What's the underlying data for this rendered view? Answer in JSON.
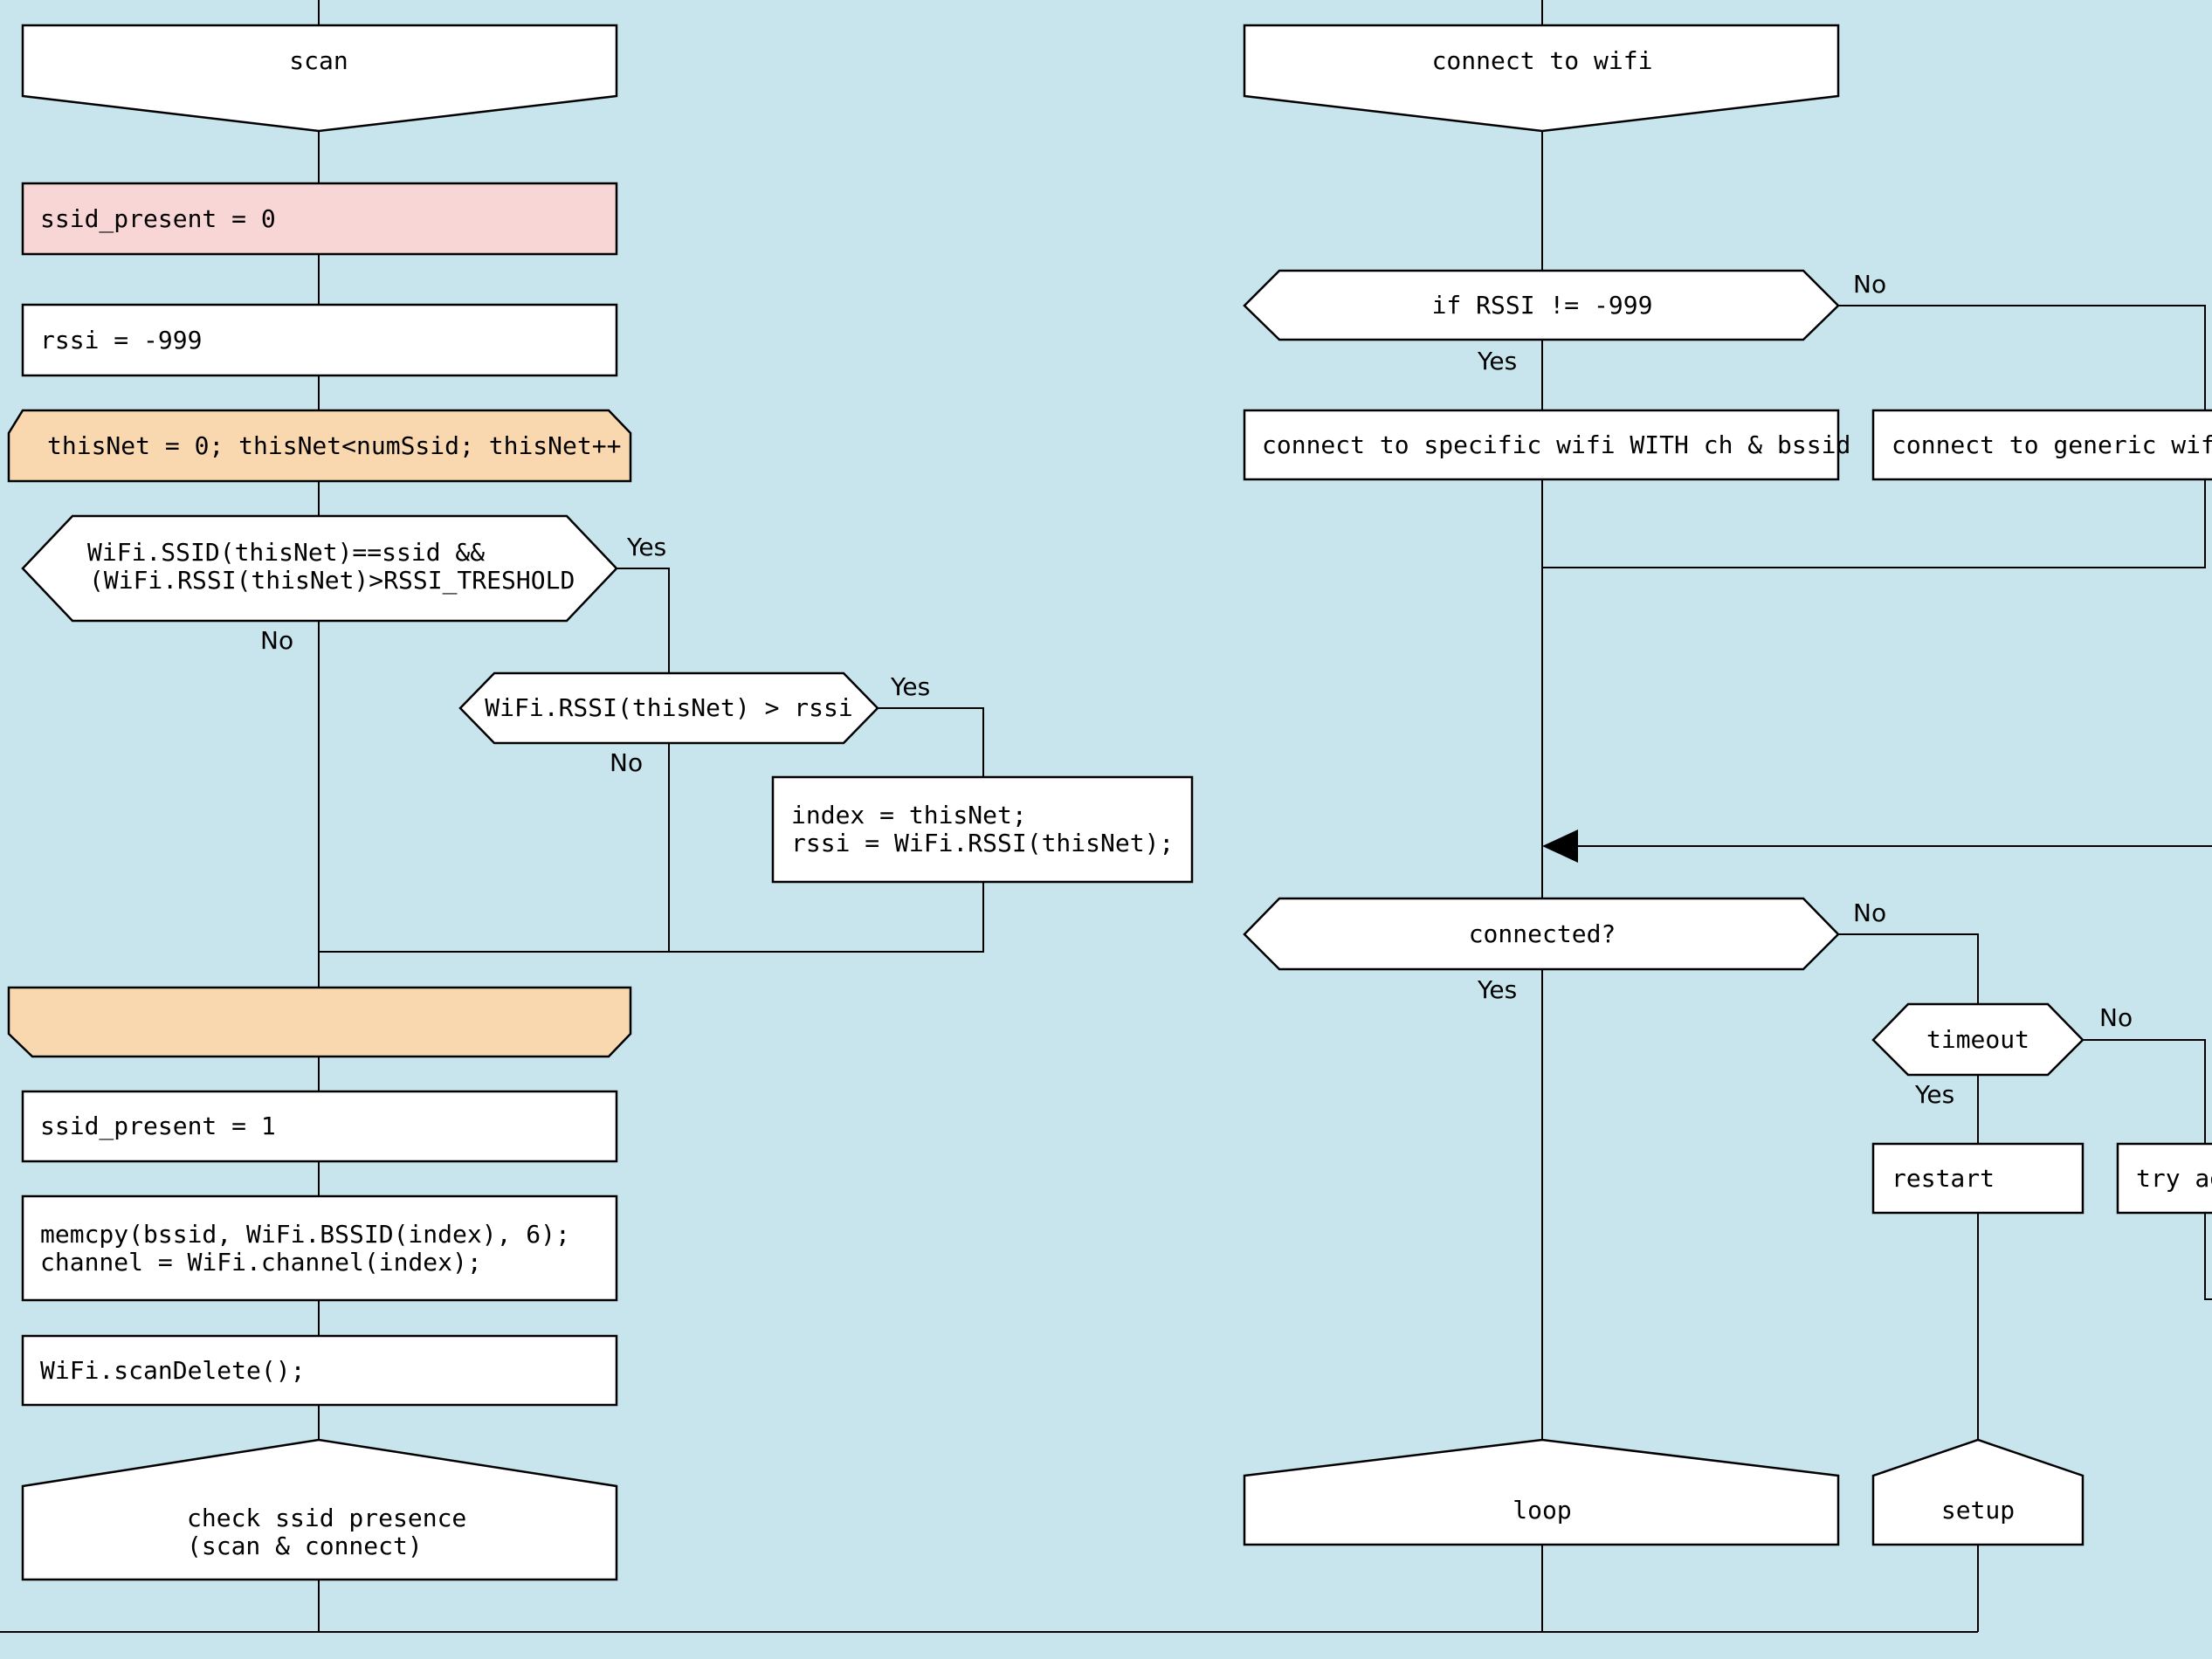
{
  "colors": {
    "background": "#c8e5ee",
    "box_default": "#ffffff",
    "box_highlight": "#f9d6d6",
    "loop_fill": "#f9d8b0",
    "stroke": "#000000"
  },
  "left_flow": {
    "start": "scan",
    "init_ssid_present": "ssid_present = 0",
    "init_rssi": "rssi = -999",
    "loop_header": "thisNet = 0; thisNet<numSsid; thisNet++",
    "decision1": {
      "line1": "WiFi.SSID(thisNet)==ssid &&",
      "line2": "(WiFi.RSSI(thisNet)>RSSI_TRESHOLD",
      "yes": "Yes",
      "no": "No"
    },
    "decision2": {
      "text": "WiFi.RSSI(thisNet) > rssi",
      "yes": "Yes",
      "no": "No"
    },
    "assign": {
      "line1": "index = thisNet;",
      "line2": "rssi = WiFi.RSSI(thisNet);"
    },
    "loop_footer": "",
    "set_present": "ssid_present = 1",
    "memcpy": {
      "line1": "memcpy(bssid, WiFi.BSSID(index), 6);",
      "line2": "channel = WiFi.channel(index);"
    },
    "scan_delete": "WiFi.scanDelete();",
    "end": {
      "line1": "check ssid presence",
      "line2": "(scan & connect)"
    }
  },
  "right_flow": {
    "start": "connect to wifi",
    "decision_rssi": {
      "text": "if RSSI != -999",
      "yes": "Yes",
      "no": "No"
    },
    "specific": "connect to specific wifi WITH ch & bssid",
    "generic": "connect to generic wifi",
    "decision_connected": {
      "text": "connected?",
      "yes": "Yes",
      "no": "No"
    },
    "decision_timeout": {
      "text": "timeout",
      "yes": "Yes",
      "no": "No"
    },
    "restart": "restart",
    "try_again": "try again",
    "end_loop": "loop",
    "end_setup": "setup"
  }
}
